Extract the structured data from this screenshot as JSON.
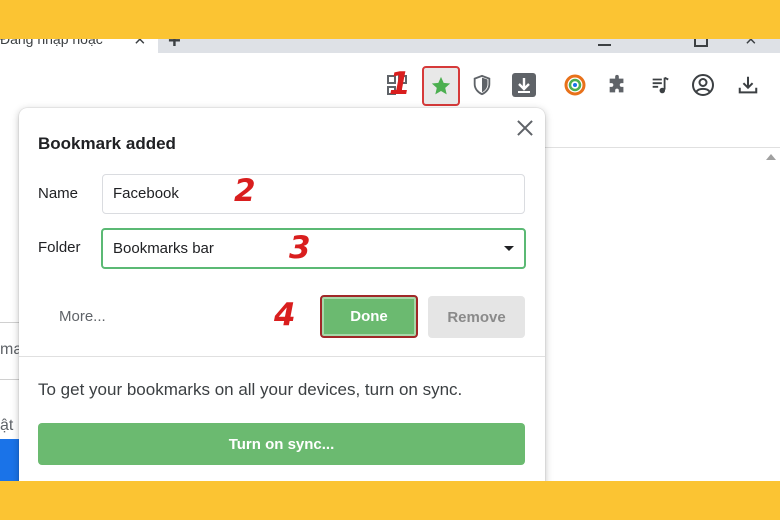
{
  "colors": {
    "frame": "#fbc433",
    "accent_green": "#6bba70",
    "callout_red": "#d91e1e",
    "focus_green": "#5bb974"
  },
  "tab": {
    "title": "Đăng nhập hoặc",
    "close_icon": "close-icon"
  },
  "titlebar": {
    "new_tab_icon": "plus-icon",
    "minimize_icon": "minimize-icon",
    "maximize_icon": "restore-icon",
    "close_icon": "close-icon"
  },
  "toolbar": {
    "icons": [
      "qr-code-icon",
      "star-icon",
      "shield-icon",
      "download-arrow-icon",
      "extension-circle-icon",
      "puzzle-icon",
      "music-list-icon",
      "account-icon",
      "download-icon"
    ]
  },
  "page": {
    "left_fragments": [
      "ma",
      "ật"
    ]
  },
  "callouts": [
    "1",
    "2",
    "3",
    "4"
  ],
  "dialog": {
    "title": "Bookmark added",
    "name_label": "Name",
    "name_value": "Facebook",
    "folder_label": "Folder",
    "folder_value": "Bookmarks bar",
    "more_label": "More...",
    "done_label": "Done",
    "remove_label": "Remove",
    "sync_text": "To get your bookmarks on all your devices, turn on sync.",
    "sync_button": "Turn on sync..."
  }
}
